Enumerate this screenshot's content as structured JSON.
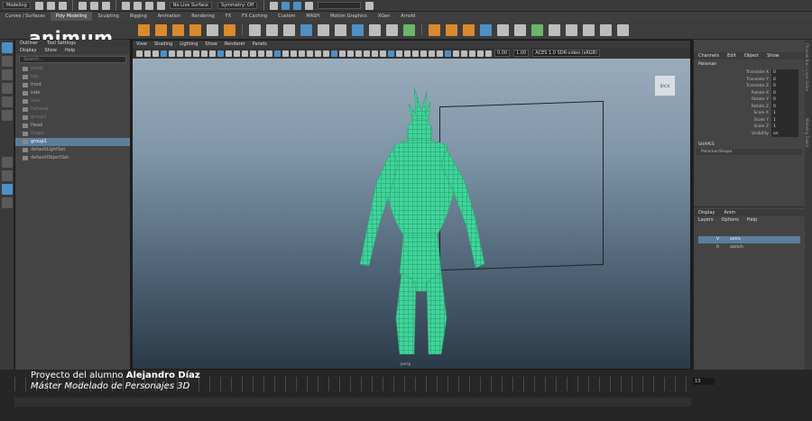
{
  "watermark": "animum",
  "statusline": {
    "workspace": "Modeling",
    "live_surface": "No Live Surface",
    "symmetry": "Symmetry: Off"
  },
  "shelf_tabs": [
    "Curves / Surfaces",
    "Poly Modeling",
    "Sculpting",
    "Rigging",
    "Animation",
    "Rendering",
    "FX",
    "FX Caching",
    "Custom",
    "MASH",
    "Motion Graphics",
    "XGen",
    "Arnold"
  ],
  "shelf_active_tab": "Poly Modeling",
  "outliner": {
    "title_tabs": [
      "Outliner",
      "Tool Settings"
    ],
    "menus": [
      "Display",
      "Show",
      "Help"
    ],
    "search_placeholder": "Search...",
    "items": [
      {
        "label": "persp",
        "state": "dim"
      },
      {
        "label": "top",
        "state": "dim"
      },
      {
        "label": "front",
        "state": "normal"
      },
      {
        "label": "side",
        "state": "normal"
      },
      {
        "label": "alex",
        "state": "dim"
      },
      {
        "label": "fathead",
        "state": "dim"
      },
      {
        "label": "group1",
        "state": "dim"
      },
      {
        "label": "Head",
        "state": "normal"
      },
      {
        "label": "shape",
        "state": "dim"
      },
      {
        "label": "group1",
        "state": "selected"
      },
      {
        "label": "defaultLightSet",
        "state": "normal"
      },
      {
        "label": "defaultObjectSet",
        "state": "normal"
      }
    ]
  },
  "viewport": {
    "menus": [
      "View",
      "Shading",
      "Lighting",
      "Show",
      "Renderer",
      "Panels"
    ],
    "field_a": "0.00",
    "field_b": "1.00",
    "colorspace": "ACES 1.0 SDR-video (sRGB)",
    "viewcube_label": "BACK",
    "camera_label": "persp"
  },
  "channel_box": {
    "menus": [
      "Channels",
      "Edit",
      "Object",
      "Show"
    ],
    "object_name": "Polisman",
    "attributes": [
      {
        "label": "Translate X",
        "value": "0"
      },
      {
        "label": "Translate Y",
        "value": "0"
      },
      {
        "label": "Translate Z",
        "value": "0"
      },
      {
        "label": "Rotate X",
        "value": "0"
      },
      {
        "label": "Rotate Y",
        "value": "0"
      },
      {
        "label": "Rotate Z",
        "value": "0"
      },
      {
        "label": "Scale X",
        "value": "1"
      },
      {
        "label": "Scale Y",
        "value": "1"
      },
      {
        "label": "Scale Z",
        "value": "1"
      },
      {
        "label": "Visibility",
        "value": "on"
      }
    ],
    "shapes_header": "SHAPES",
    "shape_name": "PolismanShape"
  },
  "layers": {
    "tabs": [
      "Display",
      "Anim"
    ],
    "menus": [
      "Layers",
      "Options",
      "Help"
    ],
    "rows": [
      {
        "v": "V",
        "name": "extra",
        "selected": true
      },
      {
        "v": "R",
        "name": "sketch",
        "selected": false
      }
    ]
  },
  "side_tabs": [
    "Channel Box / Layer Editor",
    "Modeling Toolkit"
  ],
  "timeline": {
    "current_frame": "13"
  },
  "caption": {
    "line1_prefix": "Proyecto del alumno ",
    "line1_name": "Alejandro Díaz",
    "line2": "Máster Modelado de Personajes 3D"
  }
}
